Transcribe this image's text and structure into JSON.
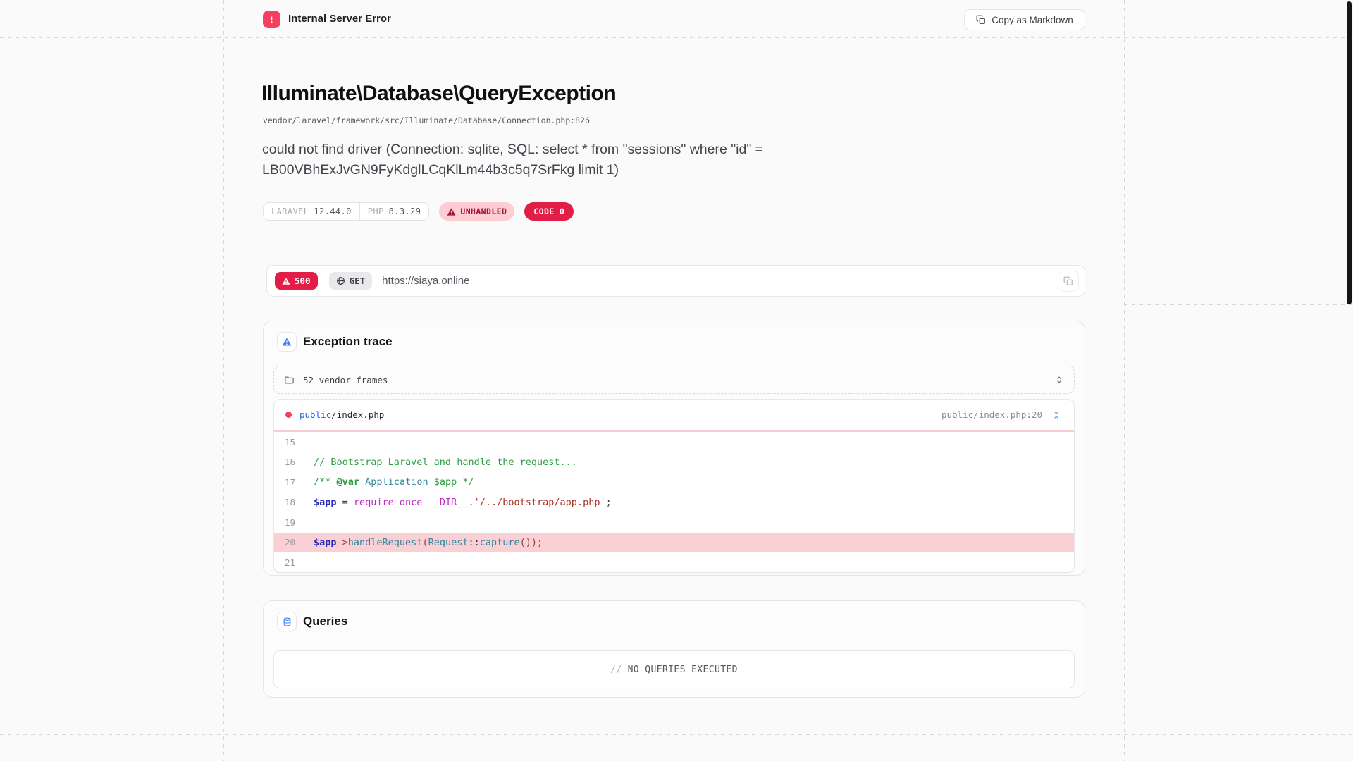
{
  "colors": {
    "accent_red": "#e11d48",
    "rose": "#f43f5e",
    "blue": "#3b82f6",
    "highlight_pink": "#fbd0d5"
  },
  "topbar": {
    "status_label": "Internal Server Error",
    "copy_button": "Copy as Markdown"
  },
  "header": {
    "exception_class": "Illuminate\\Database\\QueryException",
    "file": "vendor/laravel/framework/src/Illuminate/Database/Connection.php:826",
    "message": "could not find driver (Connection: sqlite, SQL: select * from \"sessions\" where \"id\" = LB00VBhExJvGN9FyKdglLCqKlLm44b3c5q7SrFkg limit 1)"
  },
  "badges": {
    "laravel_label": "LARAVEL",
    "laravel_version": "12.44.0",
    "php_label": "PHP",
    "php_version": "8.3.29",
    "unhandled": "UNHANDLED",
    "code": "CODE 0"
  },
  "request": {
    "status": "500",
    "method": "GET",
    "url": "https://siaya.online"
  },
  "trace": {
    "title": "Exception trace",
    "vendor_frames": "52 vendor frames",
    "frame": {
      "file_prefix": "public",
      "file_rest": "/index.php",
      "location": "public/index.php:20"
    },
    "code": {
      "highlight_line": 20,
      "lines": [
        {
          "n": 15,
          "tokens": []
        },
        {
          "n": 16,
          "tokens": [
            {
              "t": "// Bootstrap Laravel and handle the request...",
              "c": "cm"
            }
          ]
        },
        {
          "n": 17,
          "tokens": [
            {
              "t": "/** ",
              "c": "cm"
            },
            {
              "t": "@var",
              "c": "cmb"
            },
            {
              "t": " ",
              "c": "cm"
            },
            {
              "t": "Application",
              "c": "cls"
            },
            {
              "t": " $app */",
              "c": "cm"
            }
          ]
        },
        {
          "n": 18,
          "tokens": [
            {
              "t": "$app",
              "c": "var"
            },
            {
              "t": " = ",
              "c": "pun"
            },
            {
              "t": "require_once",
              "c": "mag"
            },
            {
              "t": " ",
              "c": "pun"
            },
            {
              "t": "__DIR__",
              "c": "mag"
            },
            {
              "t": ".",
              "c": "pun"
            },
            {
              "t": "'/../bootstrap/app.php'",
              "c": "str"
            },
            {
              "t": ";",
              "c": "pun"
            }
          ]
        },
        {
          "n": 19,
          "tokens": []
        },
        {
          "n": 20,
          "tokens": [
            {
              "t": "$app",
              "c": "var"
            },
            {
              "t": "->",
              "c": "op"
            },
            {
              "t": "handleRequest",
              "c": "mth"
            },
            {
              "t": "(",
              "c": "op"
            },
            {
              "t": "Request",
              "c": "cls"
            },
            {
              "t": "::",
              "c": "pun"
            },
            {
              "t": "capture",
              "c": "mth"
            },
            {
              "t": "());",
              "c": "op"
            }
          ]
        },
        {
          "n": 21,
          "tokens": []
        }
      ]
    }
  },
  "queries": {
    "title": "Queries",
    "empty_comment": "//",
    "empty_text": "NO QUERIES EXECUTED"
  }
}
